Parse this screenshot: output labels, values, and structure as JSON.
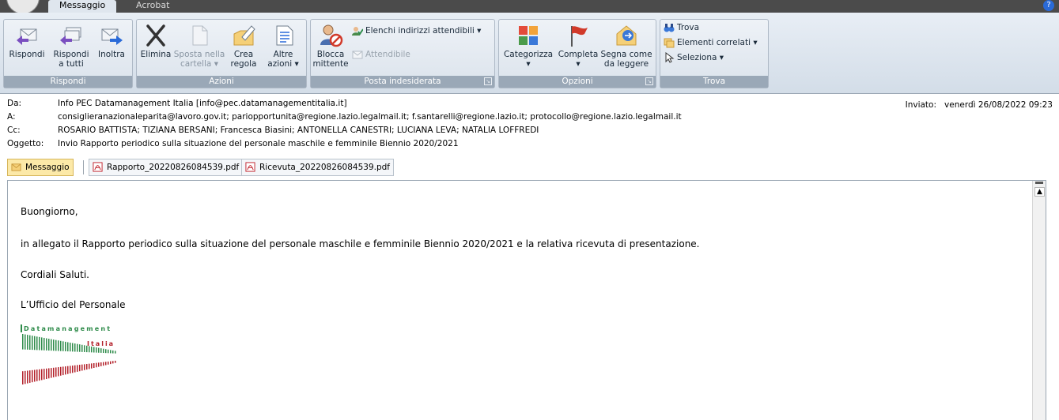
{
  "tabs": {
    "messaggio": "Messaggio",
    "acrobat": "Acrobat"
  },
  "ribbon": {
    "groups": {
      "rispondi": "Rispondi",
      "azioni": "Azioni",
      "posta": "Posta indesiderata",
      "opzioni": "Opzioni",
      "trova": "Trova"
    },
    "rispondi": {
      "line1": "Rispondi",
      "line2": ""
    },
    "rispondi_tutti": {
      "line1": "Rispondi",
      "line2": "a tutti"
    },
    "inoltra": {
      "line1": "Inoltra",
      "line2": ""
    },
    "elimina": {
      "line1": "Elimina",
      "line2": ""
    },
    "sposta": {
      "line1": "Sposta nella",
      "line2": "cartella ▾"
    },
    "crea": {
      "line1": "Crea",
      "line2": "regola"
    },
    "altre": {
      "line1": "Altre",
      "line2": "azioni ▾"
    },
    "blocca": {
      "line1": "Blocca",
      "line2": "mittente"
    },
    "elenchi": "Elenchi indirizzi attendibili ▾",
    "attendibile": "Attendibile",
    "categorizza": {
      "line1": "Categorizza",
      "line2": "▾"
    },
    "completa": {
      "line1": "Completa",
      "line2": "▾"
    },
    "segna": {
      "line1": "Segna come",
      "line2": "da leggere"
    },
    "trova": "Trova",
    "correlati": "Elementi correlati ▾",
    "seleziona": "Seleziona ▾"
  },
  "header": {
    "da_label": "Da:",
    "da_value": "Info PEC Datamanagement Italia [info@pec.datamanagementitalia.it]",
    "a_label": "A:",
    "a_value": "consiglieranazionaleparita@lavoro.gov.it; pariopportunita@regione.lazio.legalmail.it; f.santarelli@regione.lazio.it; protocollo@regione.lazio.legalmail.it",
    "cc_label": "Cc:",
    "cc_value": "ROSARIO BATTISTA; TIZIANA BERSANI; Francesca  Biasini; ANTONELLA CANESTRI; LUCIANA LEVA; NATALIA LOFFREDI",
    "oggetto_label": "Oggetto:",
    "oggetto_value": "Invio Rapporto periodico sulla situazione del personale maschile e femminile Biennio 2020/2021",
    "inviato_label": "Inviato:",
    "inviato_value": "venerdì 26/08/2022 09:23"
  },
  "attachments": {
    "messaggio": "Messaggio",
    "file1": "Rapporto_20220826084539.pdf",
    "file2": "Ricevuta_20220826084539.pdf"
  },
  "body": {
    "greeting": "Buongiorno,",
    "line1": "in allegato il Rapporto periodico sulla situazione del personale maschile e femminile Biennio 2020/2021 e la relativa ricevuta di presentazione.",
    "closing": "Cordiali Saluti.",
    "signature": "L’Ufficio del Personale",
    "logo_line1": "Datamanagement",
    "logo_line2": "Italia"
  },
  "colors": {
    "accent": "#2a6ad8",
    "logo_green": "#2e8b4a",
    "logo_red": "#b3202a"
  }
}
